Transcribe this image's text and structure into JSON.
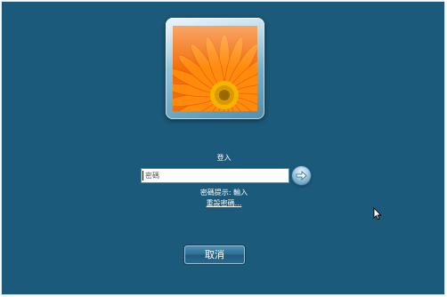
{
  "login": {
    "title": "登入",
    "password_placeholder": "密碼",
    "password_value": "",
    "hint": "密碼提示: 輸入",
    "reset_link": "重設密碼...",
    "cancel_label": "取消"
  },
  "avatar": {
    "picture": "orange-gerbera-daisy"
  },
  "icons": {
    "submit": "arrow-right-icon",
    "pointer": "mouse-pointer-icon"
  },
  "colors": {
    "background": "#1b5a7a",
    "accent": "#ff9b12"
  }
}
